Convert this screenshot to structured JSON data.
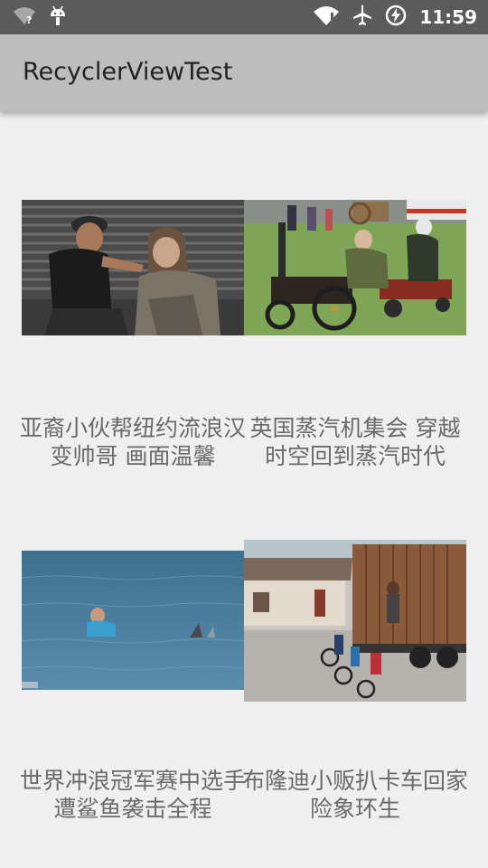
{
  "status_bar": {
    "time": "11:59",
    "icons": [
      "wifi-unknown-icon",
      "android-debug-icon",
      "wifi-alert-icon",
      "airplane-mode-icon",
      "battery-charging-icon"
    ]
  },
  "app_bar": {
    "title": "RecyclerViewTest"
  },
  "news_items": [
    {
      "title": "亚裔小伙帮纽约流浪汉变帅哥 画面温馨",
      "image": "barber-street-photo"
    },
    {
      "title": "英国蒸汽机集会 穿越时空回到蒸汽时代",
      "image": "steam-tractor-photo"
    },
    {
      "title": "世界冲浪冠军赛中选手遭鲨鱼袭击全程",
      "image": "surfer-shark-photo"
    },
    {
      "title": "布隆迪小贩扒卡车回家 险象环生",
      "image": "truck-bicycles-photo"
    }
  ]
}
